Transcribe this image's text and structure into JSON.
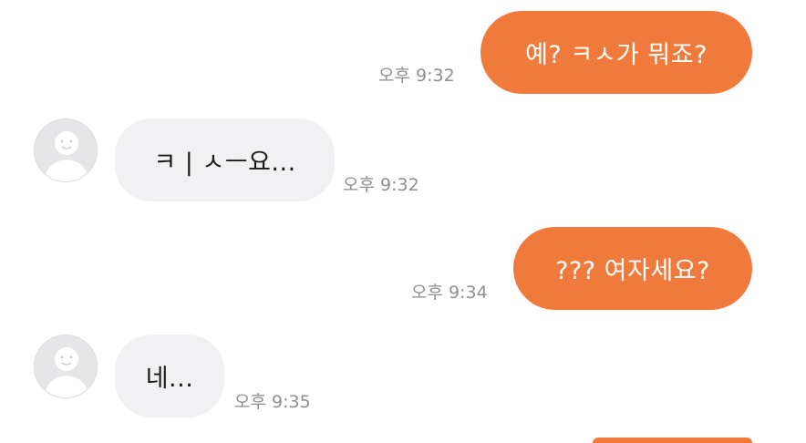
{
  "messages": [
    {
      "direction": "outgoing",
      "text": "예? ㅋㅅ가 뭐죠?",
      "time": "오후 9:32"
    },
    {
      "direction": "incoming",
      "text": "ㅋ | ㅅㅡ요...",
      "time": "오후 9:32"
    },
    {
      "direction": "outgoing",
      "text": "??? 여자세요?",
      "time": "오후 9:34"
    },
    {
      "direction": "incoming",
      "text": "네...",
      "time": "오후 9:35"
    }
  ],
  "colors": {
    "outgoing_bubble": "#f07a3b",
    "incoming_bubble": "#f1f1f3",
    "timestamp": "#8e8e93",
    "avatar": "#e6e6e8"
  },
  "icons": {
    "avatar": "default-profile-smiley-icon"
  }
}
